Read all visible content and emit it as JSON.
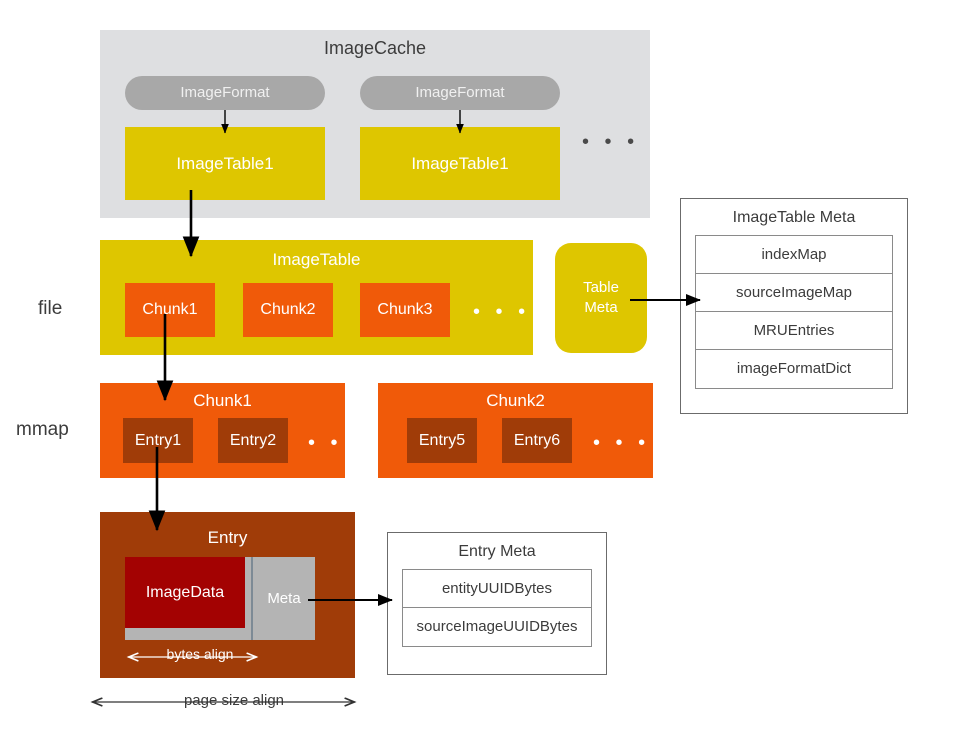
{
  "diagram": {
    "cache": {
      "title": "ImageCache",
      "groups": [
        {
          "format_label": "ImageFormat",
          "table_label": "ImageTable1"
        },
        {
          "format_label": "ImageFormat",
          "table_label": "ImageTable1"
        }
      ],
      "ellipsis": "• • •"
    },
    "rows": {
      "file_label": "file",
      "mmap_label": "mmap"
    },
    "image_table": {
      "title": "ImageTable",
      "chunks": [
        "Chunk1",
        "Chunk2",
        "Chunk3"
      ],
      "ellipsis": "• • •"
    },
    "table_meta": {
      "line1": "Table",
      "line2": "Meta"
    },
    "image_table_meta": {
      "title": "ImageTable Meta",
      "rows": [
        "indexMap",
        "sourceImageMap",
        "MRUEntries",
        "imageFormatDict"
      ]
    },
    "chunk_row": [
      {
        "title": "Chunk1",
        "entries": [
          "Entry1",
          "Entry2"
        ],
        "ellipsis": "• • •"
      },
      {
        "title": "Chunk2",
        "entries": [
          "Entry5",
          "Entry6"
        ],
        "ellipsis": "• • •"
      }
    ],
    "entry": {
      "title": "Entry",
      "image_data_label": "ImageData",
      "meta_label": "Meta",
      "bytes_align_label": "bytes align",
      "page_size_align_label": "page size align"
    },
    "entry_meta": {
      "title": "Entry Meta",
      "rows": [
        "entityUUIDBytes",
        "sourceImageUUIDBytes"
      ]
    },
    "colors": {
      "cache_background": "#dedfe1",
      "pill": "#a8a8a8",
      "yellow": "#dec600",
      "orange": "#f05a09",
      "brown": "#a03c08",
      "dark_red": "#a30202",
      "gray_block": "#b4b4b4",
      "arrow": "#000000"
    }
  }
}
